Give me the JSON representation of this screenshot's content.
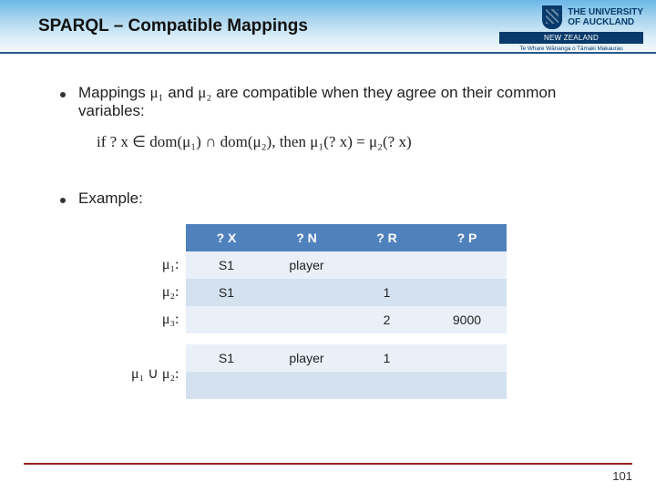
{
  "header": {
    "title": "SPARQL – Compatible Mappings",
    "university": {
      "name_line1": "THE UNIVERSITY",
      "name_line2": "OF AUCKLAND",
      "bar": "NEW ZEALAND",
      "maori": "Te Whare Wānanga o Tāmaki Makaurau"
    }
  },
  "body": {
    "bullet1_prefix": "Mappings ",
    "mu1": "μ₁",
    "and_word": " and ",
    "mu2": "μ₂",
    "bullet1_suffix": " are compatible when they agree on their common variables:",
    "if_word": "if ",
    "cond": "? x ∈ dom(μ₁) ∩ dom(μ₂)",
    "then_word": ", then ",
    "eqn": "μ₁(? x) = μ₂(? x)",
    "bullet2": "Example:"
  },
  "mu_labels": {
    "r1": "μ₁:",
    "r2": "μ₂:",
    "r3": "μ₃:",
    "r4": "μ₁ ∪ μ₂:"
  },
  "table": {
    "headers": [
      "? X",
      "? N",
      "? R",
      "? P"
    ],
    "rows": [
      [
        "S1",
        "player",
        "",
        ""
      ],
      [
        "S1",
        "",
        "1",
        ""
      ],
      [
        "",
        "",
        "2",
        "9000"
      ]
    ],
    "union_row": [
      "S1",
      "player",
      "1",
      ""
    ],
    "blank_row": [
      "",
      "",
      "",
      ""
    ]
  },
  "footer": {
    "page": "101"
  }
}
